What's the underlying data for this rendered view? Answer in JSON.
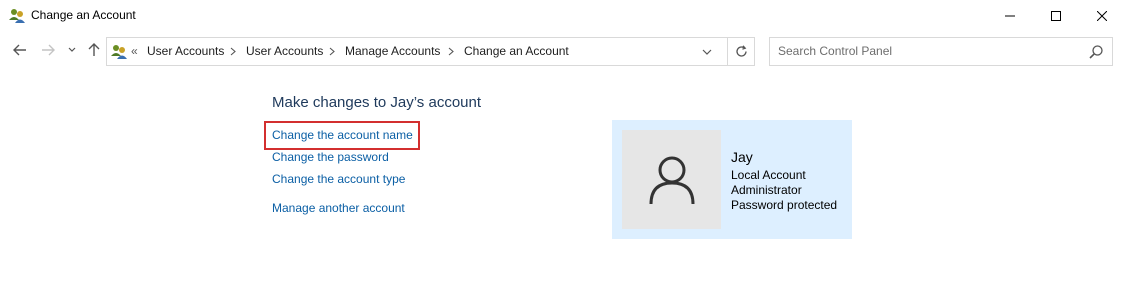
{
  "window": {
    "title": "Change an Account",
    "icon": "user-accounts-icon"
  },
  "titlebar_buttons": [
    "minimize-icon",
    "maximize-icon",
    "close-icon"
  ],
  "navigation": {
    "back_icon": "arrow-left-icon",
    "forward_icon": "arrow-right-icon",
    "recent_icon": "chevron-down-icon",
    "up_icon": "arrow-up-icon"
  },
  "address_bar": {
    "overflow": "«",
    "breadcrumbs": [
      "User Accounts",
      "User Accounts",
      "Manage Accounts",
      "Change an Account"
    ],
    "refresh_icon": "refresh-icon"
  },
  "search": {
    "placeholder": "Search Control Panel",
    "icon": "search-icon"
  },
  "main": {
    "heading": "Make changes to Jay’s account",
    "tasks": [
      "Change the account name",
      "Change the password",
      "Change the account type",
      "Manage another account"
    ],
    "highlight_color": "#d32f2f"
  },
  "account": {
    "name": "Jay",
    "type": "Local Account",
    "role": "Administrator",
    "status": "Password protected",
    "avatar_icon": "user-avatar-icon",
    "panel_color": "#ddefff"
  }
}
